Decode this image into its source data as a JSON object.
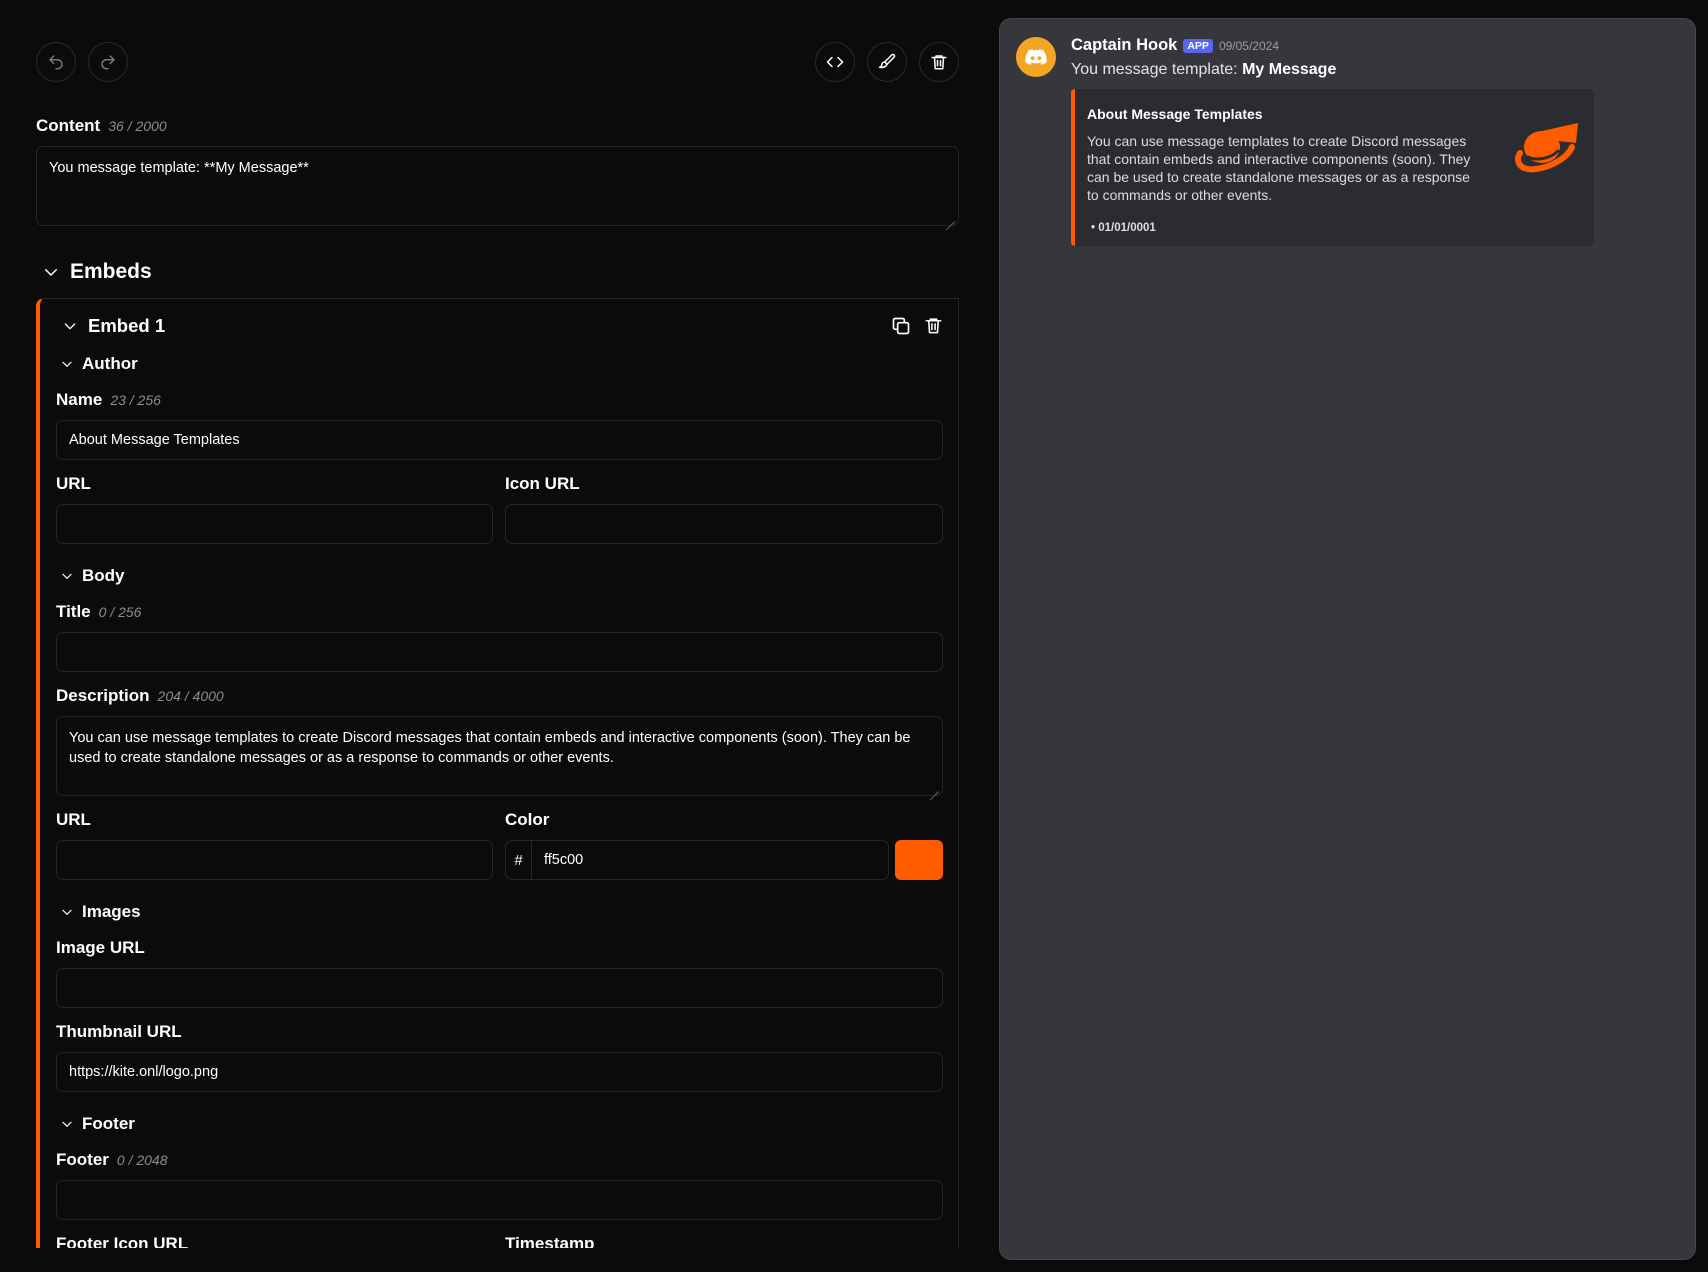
{
  "toolbar": {
    "undo_icon": "undo-icon",
    "redo_icon": "redo-icon",
    "code_icon": "code-icon",
    "brush_icon": "paintbrush-icon",
    "trash_icon": "trash-icon"
  },
  "content": {
    "label": "Content",
    "count": "36 / 2000",
    "value": "You message template: **My Message**"
  },
  "embeds": {
    "label": "Embeds",
    "embed_label": "Embed 1",
    "author": {
      "section": "Author",
      "name_label": "Name",
      "name_count": "23 / 256",
      "name_value": "About Message Templates",
      "url_label": "URL",
      "url_value": "",
      "icon_url_label": "Icon URL",
      "icon_url_value": ""
    },
    "body": {
      "section": "Body",
      "title_label": "Title",
      "title_count": "0 / 256",
      "title_value": "",
      "description_label": "Description",
      "description_count": "204 / 4000",
      "description_value": "You can use message templates to create Discord messages that contain embeds and interactive components (soon). They can be used to create standalone messages or as a response to commands or other events.",
      "url_label": "URL",
      "url_value": "",
      "color_label": "Color",
      "color_prefix": "#",
      "color_value": "ff5c00"
    },
    "images": {
      "section": "Images",
      "image_url_label": "Image URL",
      "image_url_value": "",
      "thumbnail_url_label": "Thumbnail URL",
      "thumbnail_url_value": "https://kite.onl/logo.png"
    },
    "footer": {
      "section": "Footer",
      "footer_label": "Footer",
      "footer_count": "0 / 2048",
      "footer_value": "",
      "footer_icon_url_label": "Footer Icon URL",
      "timestamp_label": "Timestamp"
    }
  },
  "preview": {
    "username": "Captain Hook",
    "badge": "APP",
    "timestamp": "09/05/2024",
    "message_prefix": "You message template: ",
    "message_bold": "My Message",
    "embed_author": "About Message Templates",
    "embed_description": "You can use message templates to create Discord messages that contain embeds and interactive components (soon). They can be used to create standalone messages or as a response to commands or other events.",
    "embed_footer": "• 01/01/0001"
  },
  "colors": {
    "accent": "#ff5c00",
    "avatar": "#f5a524",
    "badge": "#5865f2",
    "preview_bg": "#36373c",
    "embed_bg": "#2b2c31"
  }
}
